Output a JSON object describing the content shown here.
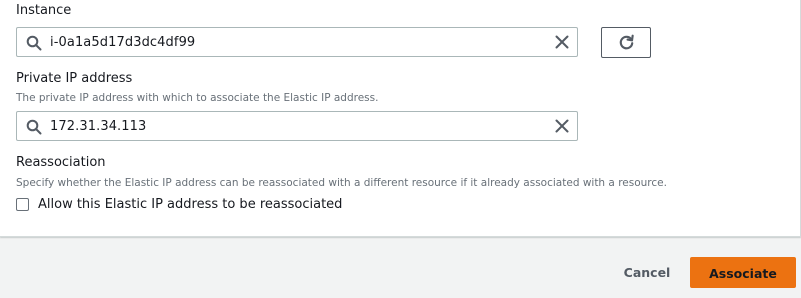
{
  "instance": {
    "label": "Instance",
    "value": "i-0a1a5d17d3dc4df99",
    "search_icon": "search-icon",
    "clear_icon": "close-icon",
    "refresh_icon": "refresh-icon"
  },
  "private_ip": {
    "label": "Private IP address",
    "description": "The private IP address with which to associate the Elastic IP address.",
    "value": "172.31.34.113",
    "search_icon": "search-icon",
    "clear_icon": "close-icon"
  },
  "reassociation": {
    "label": "Reassociation",
    "description": "Specify whether the Elastic IP address can be reassociated with a different resource if it already associated with a resource.",
    "checkbox_label": "Allow this Elastic IP address to be reassociated",
    "checked": false
  },
  "footer": {
    "cancel_label": "Cancel",
    "associate_label": "Associate"
  },
  "colors": {
    "primary_button": "#ec7211",
    "text": "#16191f",
    "muted_text": "#687078",
    "border": "#aab7b8",
    "page_background": "#f2f3f3"
  }
}
